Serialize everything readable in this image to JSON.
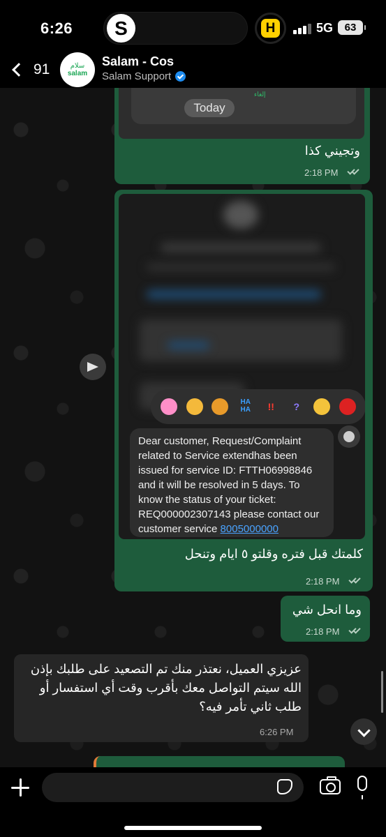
{
  "status_bar": {
    "time": "6:26",
    "island_app": "S",
    "live_activity": "H",
    "network": "5G",
    "battery": "63"
  },
  "header": {
    "back_count": "91",
    "avatar_text_ar": "سلام",
    "avatar_text_en": "salam",
    "name": "Salam - Cos",
    "subtitle": "Salam Support"
  },
  "messages": [
    {
      "direction": "out",
      "image_text": "إلغاء",
      "image_date_chip": "Today",
      "text": "وتجيني كذا",
      "time": "2:18 PM",
      "read": true
    },
    {
      "direction": "out",
      "reactions": [
        "heart",
        "thumbs-up",
        "thumbs-down",
        "haha",
        "!!",
        "?",
        "laugh",
        "heart-red"
      ],
      "reaction_labels": {
        "haha": "HA\nHA",
        "exclaim": "!!",
        "question": "?"
      },
      "sms_text": "Dear customer, Request/Complaint related to Service extendhas been issued for service ID: FTTH06998846 and it will be resolved in 5 days. To know the status of your ticket: REQ000002307143 please contact our customer service ",
      "sms_link": "8005000000",
      "text": "كلمتك قبل فتره وقلتو ٥ ايام وتنحل",
      "time": "2:18 PM",
      "read": true
    },
    {
      "direction": "out",
      "text": "وما انحل شي",
      "time": "2:18 PM",
      "read": true
    },
    {
      "direction": "in",
      "text": "عزيزي العميل، نعتذر منك تم التصعيد على طلبك بإذن الله سيتم التواصل معك بأقرب وقت أي استفسار أو طلب ثاني تأمر فيه؟",
      "time": "6:26 PM"
    }
  ],
  "composer": {
    "placeholder": ""
  },
  "colors": {
    "outgoing_bubble": "#1e5c3c",
    "incoming_bubble": "#262626",
    "link": "#4aa3ff",
    "verified": "#1d8cf0"
  }
}
